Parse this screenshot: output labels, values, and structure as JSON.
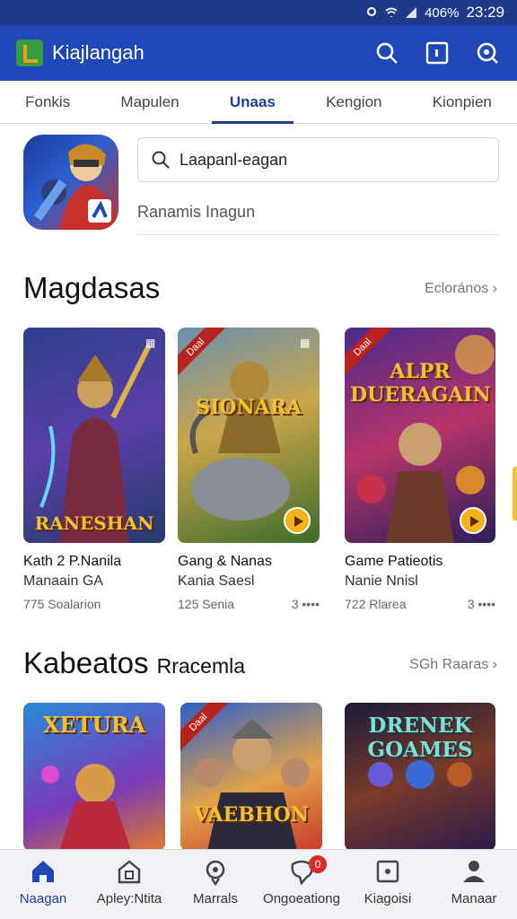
{
  "status_bar": {
    "signal": "406%",
    "time": "23:29"
  },
  "app_bar": {
    "title": "Kiajlangah",
    "icons": [
      "search-icon",
      "square-icon",
      "search-alt-icon"
    ]
  },
  "tabs": [
    {
      "label": "Fonkis",
      "active": false
    },
    {
      "label": "Mapulen",
      "active": true
    },
    {
      "label": "Unaas",
      "active": true
    },
    {
      "label": "Kengion",
      "active": false
    },
    {
      "label": "Kionpien",
      "active": false
    }
  ],
  "search": {
    "value": "Laapanl-eagan",
    "subtitle": "Ranamis Inagun"
  },
  "section1": {
    "title": "Magdasas",
    "link": "Eclorános",
    "cards": [
      {
        "art_title": "RANESHAN",
        "name": "Kath 2 P.Nanila",
        "dev": "Manaain GA",
        "meta": "775 Soalarion",
        "meta_right": "",
        "ribbon": ""
      },
      {
        "art_title": "SIONARA",
        "name": "Gang & Nanas",
        "dev": "Kania Saesl",
        "meta": "125 Senia",
        "meta_right": "3 ••••",
        "ribbon": "Daal"
      },
      {
        "art_title": "ALPR DUERAGAIN",
        "name": "Game Patieotis",
        "dev": "Nanie Nnisl",
        "meta": "722 Rlarea",
        "meta_right": "3 ••••",
        "ribbon": "Daal"
      }
    ]
  },
  "section2": {
    "title": "Kabeatos",
    "title_suffix": "Rracemla",
    "link": "SGh Raaras",
    "cards": [
      {
        "art_title": "XETURA"
      },
      {
        "art_title": "VAEBHON",
        "ribbon": "Daal"
      },
      {
        "art_title": "DRENEK GOAMES"
      }
    ]
  },
  "bottom_nav": [
    {
      "label": "Naagan",
      "icon": "home-icon",
      "active": true
    },
    {
      "label": "Apley:Ntita",
      "icon": "store-icon",
      "active": false
    },
    {
      "label": "Marrals",
      "icon": "gear-shield-icon",
      "active": false
    },
    {
      "label": "Ongoeationg",
      "icon": "chat-icon",
      "active": false,
      "badge": "0"
    },
    {
      "label": "Kiagoisi",
      "icon": "tablet-icon",
      "active": false
    },
    {
      "label": "Manaar",
      "icon": "person-icon",
      "active": false
    }
  ],
  "colors": {
    "primary": "#2047b9",
    "status": "#203a8a",
    "accent": "#f2c132",
    "badge": "#d42a2a"
  }
}
